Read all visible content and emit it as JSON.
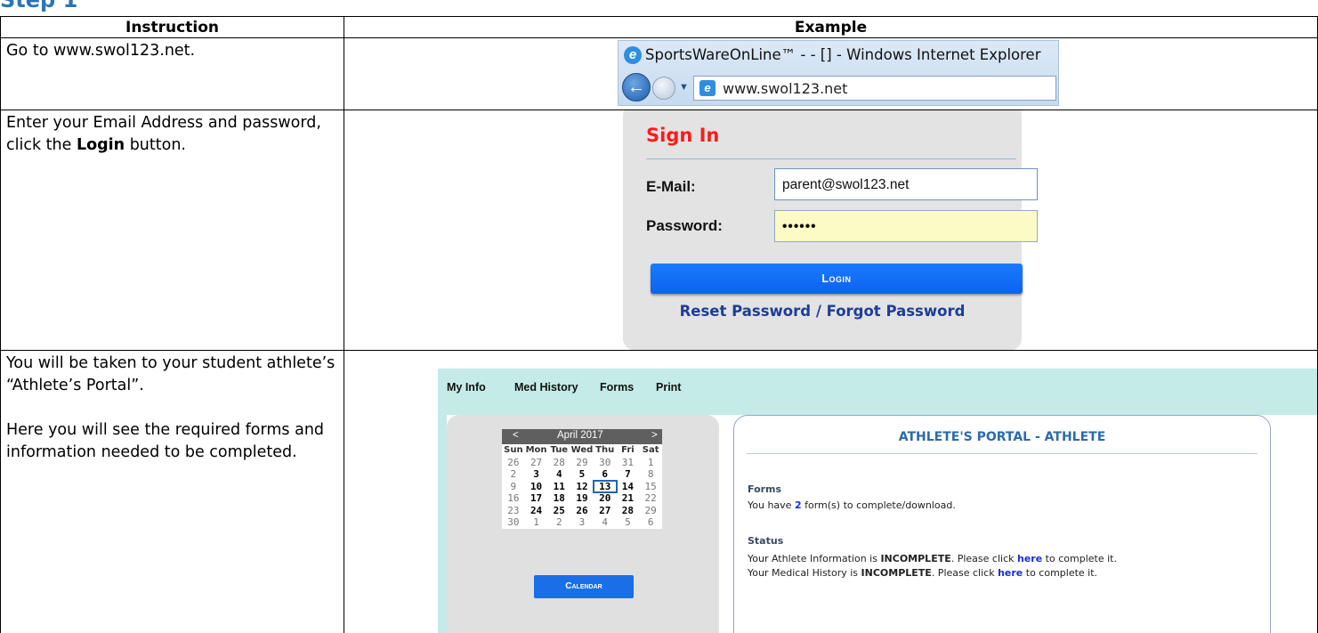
{
  "table": {
    "header_instruction": "Instruction",
    "header_example": "Example"
  },
  "step1": {
    "text": "Go to www.swol123.net.",
    "browser": {
      "title": "SportsWareOnLine™ - - [] - Windows Internet Explorer",
      "url": "www.swol123.net"
    }
  },
  "step2": {
    "text_before": "Enter your Email Address and password, click the ",
    "text_bold": "Login",
    "text_after": " button.",
    "signin": {
      "title": "Sign In",
      "email_label": "E-Mail:",
      "email_value": "parent@swol123.net",
      "password_label": "Password:",
      "password_value": "••••••",
      "login_button": "Login",
      "reset_link": "Reset Password / Forgot Password"
    }
  },
  "step3": {
    "text_p1": "You will be taken to your student athlete’s “Athlete’s Portal”.",
    "text_p2": "Here you will see the required forms and information needed to be completed.",
    "portal": {
      "menu": [
        "My Info",
        "Med History",
        "Forms",
        "Print"
      ],
      "calendar": {
        "prev": "<",
        "month": "April 2017",
        "next": ">",
        "day_names": [
          "Sun",
          "Mon",
          "Tue",
          "Wed",
          "Thu",
          "Fri",
          "Sat"
        ],
        "weeks": [
          [
            "26",
            "27",
            "28",
            "29",
            "30",
            "31",
            "1"
          ],
          [
            "2",
            "3",
            "4",
            "5",
            "6",
            "7",
            "8"
          ],
          [
            "9",
            "10",
            "11",
            "12",
            "13",
            "14",
            "15"
          ],
          [
            "16",
            "17",
            "18",
            "19",
            "20",
            "21",
            "22"
          ],
          [
            "23",
            "24",
            "25",
            "26",
            "27",
            "28",
            "29"
          ],
          [
            "30",
            "1",
            "2",
            "3",
            "4",
            "5",
            "6"
          ]
        ],
        "today": "13",
        "button": "Calendar"
      },
      "title": "ATHLETE'S PORTAL - ATHLETE",
      "forms_heading": "Forms",
      "forms_text_before": "You have ",
      "forms_count": "2",
      "forms_text_after": " form(s) to complete/download.",
      "status_heading": "Status",
      "status_line1_before": "Your Athlete Information is ",
      "status_line1_state": "INCOMPLETE",
      "status_line1_mid": ". Please click ",
      "status_line1_link": "here",
      "status_line1_after": " to complete it.",
      "status_line2_before": "Your Medical History is ",
      "status_line2_state": "INCOMPLETE",
      "status_line2_mid": ". Please click ",
      "status_line2_link": "here",
      "status_line2_after": " to complete it."
    }
  }
}
